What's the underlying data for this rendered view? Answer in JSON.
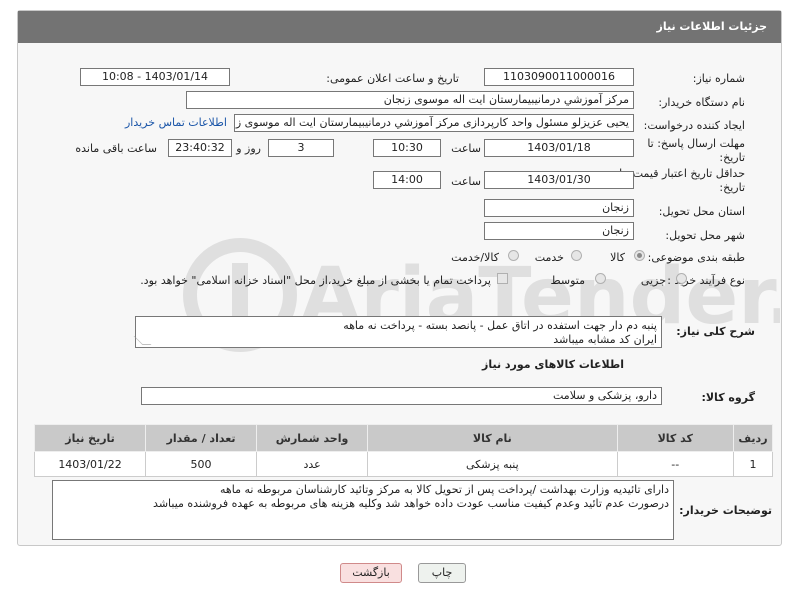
{
  "header": {
    "title": "جزئیات اطلاعات نیاز"
  },
  "fields": {
    "need_number_label": "شماره نیاز:",
    "need_number": "1103090011000016",
    "announce_label": "تاریخ و ساعت اعلان عمومی:",
    "announce_value": "1403/01/14 - 10:08",
    "buyer_org_label": "نام دستگاه خریدار:",
    "buyer_org": "مرکز آموزشي درمانيبيمارستان ايت اله موسوی زنجان",
    "creator_label": "ایجاد کننده درخواست:",
    "creator": "یحیی عزیزلو مسئول واحد کارپردازی مرکز آموزشي درمانيبيمارستان ايت اله موسوی زنجان",
    "contact_link": "اطلاعات تماس خریدار",
    "reply_deadline_label_1": "مهلت ارسال پاسخ: تا",
    "reply_deadline_label_2": "تاریخ:",
    "reply_date": "1403/01/18",
    "time_label": "ساعت",
    "reply_time": "10:30",
    "days_value": "3",
    "days_label": "روز و",
    "remaining_time": "23:40:32",
    "remaining_label": "ساعت باقی مانده",
    "validity_label_1": "حداقل تاریخ اعتبار قیمت: تا",
    "validity_label_2": "تاریخ:",
    "validity_date": "1403/01/30",
    "validity_time": "14:00",
    "province_label": "استان محل تحویل:",
    "province": "زنجان",
    "city_label": "شهر محل تحویل:",
    "city": "زنجان",
    "category_label": "طبقه بندی موضوعی:",
    "category_options": [
      "کالا",
      "خدمت",
      "کالا/خدمت"
    ],
    "process_label": "نوع فرآیند خرید :",
    "process_options": [
      "جزیی",
      "متوسط"
    ],
    "payment_note": "پرداخت تمام یا بخشی از مبلغ خرید،از محل \"اسناد خزانه اسلامی\" خواهد بود."
  },
  "description": {
    "label": "شرح کلی نیاز:",
    "line1": "پنبه دم دار جهت استفده در اتاق عمل - پانصد بسته - پرداخت نه ماهه",
    "line2": "ایران کد مشابه میباشد"
  },
  "goods": {
    "title": "اطلاعات کالاهای مورد نیاز",
    "group_label": "گروه کالا:",
    "group_value": "دارو، پزشکی و سلامت",
    "columns": [
      "ردیف",
      "کد کالا",
      "نام کالا",
      "واحد شمارش",
      "تعداد / مقدار",
      "تاریخ نیاز"
    ],
    "rows": [
      [
        "1",
        "--",
        "پنبه پزشکی",
        "عدد",
        "500",
        "1403/01/22"
      ]
    ]
  },
  "buyer_notes": {
    "label": "توضیحات خریدار:",
    "line1": "دارای تائیدیه وزارت بهداشت /پرداخت پس از تحویل کالا به مرکز وتائید کارشناسان مربوطه نه ماهه",
    "line2": "درصورت عدم تائید وعدم کیفیت مناسب عودت داده خواهد شد وکلیه هزینه های مربوطه به عهده فروشنده میباشد"
  },
  "buttons": {
    "print": "چاپ",
    "back": "بازگشت"
  },
  "watermark": {
    "text": "AriaTender.neT"
  }
}
